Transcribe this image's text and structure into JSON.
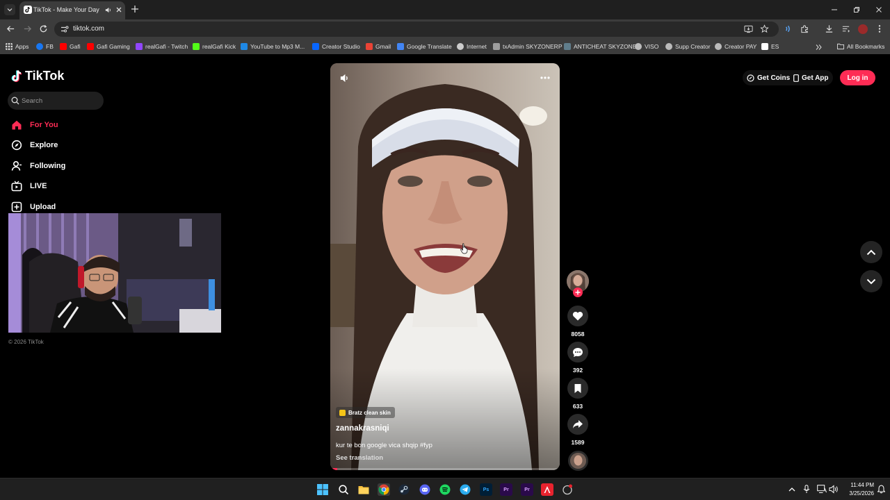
{
  "browser": {
    "tab_title": "TikTok - Make Your Day",
    "url": "tiktok.com",
    "bookmarks": [
      {
        "label": "Apps",
        "color": "#4285f4"
      },
      {
        "label": "FB",
        "color": "#1877f2"
      },
      {
        "label": "Gafi",
        "color": "#ff0000"
      },
      {
        "label": "Gafi Gaming",
        "color": "#ff0000"
      },
      {
        "label": "realGafi - Twitch",
        "color": "#9146ff"
      },
      {
        "label": "realGafi Kick",
        "color": "#53fc18"
      },
      {
        "label": "YouTube to Mp3 M...",
        "color": "#1e88e5"
      },
      {
        "label": "Creator Studio",
        "color": "#0866ff"
      },
      {
        "label": "Gmail",
        "color": "#ea4335"
      },
      {
        "label": "Google Translate",
        "color": "#4285f4"
      },
      {
        "label": "Internet",
        "color": "#cccccc"
      },
      {
        "label": "txAdmin SKYZONERP",
        "color": "#9e9e9e"
      },
      {
        "label": "ANTICHEAT SKYZONE",
        "color": "#607d8b"
      },
      {
        "label": "VISO",
        "color": "#bbbbbb"
      },
      {
        "label": "Supp Creator",
        "color": "#bbbbbb"
      },
      {
        "label": "Creator PAY",
        "color": "#bbbbbb"
      },
      {
        "label": "ES",
        "color": "#ffffff"
      }
    ],
    "all_bookmarks_label": "All Bookmarks"
  },
  "tiktok": {
    "logo_text": "TikTok",
    "search_placeholder": "Search",
    "nav": [
      {
        "label": "For You",
        "icon": "home-icon",
        "active": true
      },
      {
        "label": "Explore",
        "icon": "compass-icon",
        "active": false
      },
      {
        "label": "Following",
        "icon": "user-icon",
        "active": false
      },
      {
        "label": "LIVE",
        "icon": "live-tv-icon",
        "active": false
      },
      {
        "label": "Upload",
        "icon": "upload-plus-icon",
        "active": false
      }
    ],
    "copyright": "© 2026 TikTok",
    "top_right": {
      "get_coins": "Get Coins",
      "get_app": "Get App",
      "login": "Log in"
    },
    "video": {
      "effect_tag": "Bratz clean skin",
      "username": "zannakrasniqi",
      "caption": "kur te bon google vica shqip #fyp",
      "see_translation": "See translation",
      "progress": 0.03
    },
    "actions": {
      "likes": "8058",
      "comments": "392",
      "saves": "633",
      "shares": "1589"
    },
    "accent_color": "#fe2c55"
  },
  "taskbar": {
    "time": "11:44 PM",
    "date": "3/25/2026"
  }
}
